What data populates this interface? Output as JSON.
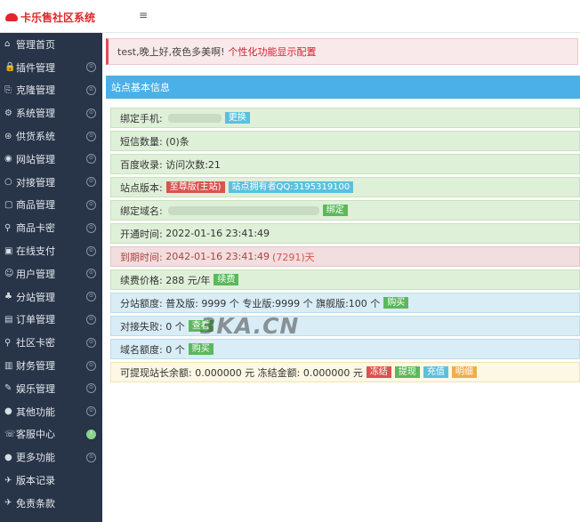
{
  "app": {
    "title": "卡乐售社区系统",
    "menu_toggle": "≡"
  },
  "sidebar": {
    "items": [
      {
        "icon": "⌂",
        "label": "管理首页",
        "arrow": ""
      },
      {
        "icon": "🔒",
        "label": "插件管理",
        "arrow": "⊙"
      },
      {
        "icon": "⎘",
        "label": "克隆管理",
        "arrow": "⊙"
      },
      {
        "icon": "⚙",
        "label": "系统管理",
        "arrow": "⊙"
      },
      {
        "icon": "⊛",
        "label": "供货系统",
        "arrow": "⊙"
      },
      {
        "icon": "◉",
        "label": "网站管理",
        "arrow": "⊙"
      },
      {
        "icon": "○",
        "label": "对接管理",
        "arrow": "⊙"
      },
      {
        "icon": "▢",
        "label": "商品管理",
        "arrow": "⊙"
      },
      {
        "icon": "⚲",
        "label": "商品卡密",
        "arrow": "⊙"
      },
      {
        "icon": "▣",
        "label": "在线支付",
        "arrow": "⊙"
      },
      {
        "icon": "☺",
        "label": "用户管理",
        "arrow": "⊙"
      },
      {
        "icon": "♣",
        "label": "分站管理",
        "arrow": "⊙"
      },
      {
        "icon": "▤",
        "label": "订单管理",
        "arrow": "⊙"
      },
      {
        "icon": "⚲",
        "label": "社区卡密",
        "arrow": "⊙"
      },
      {
        "icon": "▥",
        "label": "财务管理",
        "arrow": "⊙"
      },
      {
        "icon": "✎",
        "label": "娱乐管理",
        "arrow": "⊙"
      },
      {
        "icon": "●",
        "label": "其他功能",
        "arrow": "⊙"
      },
      {
        "icon": "☏",
        "label": "客服中心",
        "arrow": "!"
      },
      {
        "icon": "●",
        "label": "更多功能",
        "arrow": "⊙"
      },
      {
        "icon": "✈",
        "label": "版本记录",
        "arrow": ""
      },
      {
        "icon": "✈",
        "label": "免责条款",
        "arrow": ""
      }
    ]
  },
  "notice": {
    "text": "test,晚上好,夜色多美啊!",
    "link": "个性化功能显示配置"
  },
  "panel": {
    "title": "站点基本信息"
  },
  "info": {
    "phone_label": "绑定手机:",
    "change_btn": "更换",
    "sms_label": "短信数量:",
    "sms_value": "(0)条",
    "baidu_label": "百度收录:",
    "baidu_value": "访问次数:21",
    "version_label": "站点版本:",
    "version_tag": "至尊版(主站)",
    "owner_tag": "站点拥有者QQ:3195319100",
    "domain_label": "绑定域名:",
    "domain_btn": "绑定",
    "open_label": "开通时间:",
    "open_value": "2022-01-16 23:41:49",
    "expire_label": "到期时间:",
    "expire_value": "2042-01-16 23:41:49",
    "expire_days": "(7291)天",
    "renew_label": "续费价格:",
    "renew_value": "288 元/年",
    "renew_btn": "续费",
    "quota_label": "分站额度:",
    "quota_value": "普及版: 9999 个  专业版:9999 个  旗舰版:100 个",
    "quota_btn": "购买",
    "fail_label": "对接失败:",
    "fail_value": "0 个",
    "fail_btn": "查看",
    "dquota_label": "域名额度:",
    "dquota_value": "0 个",
    "dquota_btn": "购买",
    "balance_text": "可提现站长余额: 0.000000 元  冻结金额: 0.000000 元",
    "freeze_btn": "冻结",
    "withdraw_btn": "提现",
    "recharge_btn": "充值",
    "detail_btn": "明细"
  },
  "watermark": "3KA.CN",
  "colors": {
    "accent": "#4bb0e8",
    "brand": "#e0262a",
    "sidebar": "#283447"
  }
}
